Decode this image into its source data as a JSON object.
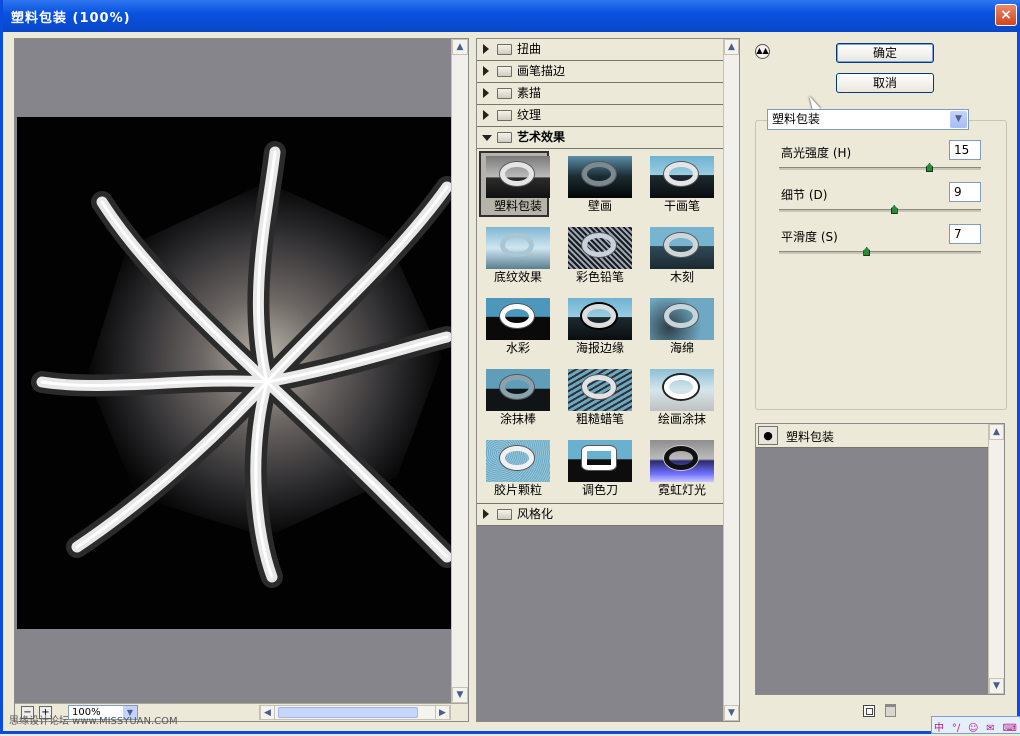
{
  "window": {
    "title": "塑料包装 (100%)",
    "close_glyph": "×"
  },
  "preview": {
    "zoom": "100%"
  },
  "categories_top": [
    {
      "label": "扭曲"
    },
    {
      "label": "画笔描边"
    },
    {
      "label": "素描"
    },
    {
      "label": "纹理"
    },
    {
      "label": "艺术效果"
    }
  ],
  "categories_bottom": [
    {
      "label": "风格化"
    }
  ],
  "filters": [
    {
      "label": "塑料包装",
      "selected": true
    },
    {
      "label": "壁画"
    },
    {
      "label": "干画笔"
    },
    {
      "label": "底纹效果"
    },
    {
      "label": "彩色铅笔"
    },
    {
      "label": "木刻"
    },
    {
      "label": "水彩"
    },
    {
      "label": "海报边缘"
    },
    {
      "label": "海绵"
    },
    {
      "label": "涂抹棒"
    },
    {
      "label": "粗糙蜡笔"
    },
    {
      "label": "绘画涂抹"
    },
    {
      "label": "胶片颗粒"
    },
    {
      "label": "调色刀"
    },
    {
      "label": "霓虹灯光"
    }
  ],
  "buttons": {
    "ok": "确定",
    "cancel": "取消"
  },
  "filter_select": {
    "value": "塑料包装"
  },
  "params": [
    {
      "label": "高光强度 (H)",
      "value": "15",
      "fraction": 0.75
    },
    {
      "label": "细节 (D)",
      "value": "9",
      "fraction": 0.57
    },
    {
      "label": "平滑度 (S)",
      "value": "7",
      "fraction": 0.43
    }
  ],
  "layers": [
    {
      "name": "塑料包装"
    }
  ],
  "watermark": "思缘设计论坛 www.MISSYUAN.COM",
  "tray": [
    "中",
    "°∕",
    "☺",
    "✉",
    "⌨"
  ]
}
